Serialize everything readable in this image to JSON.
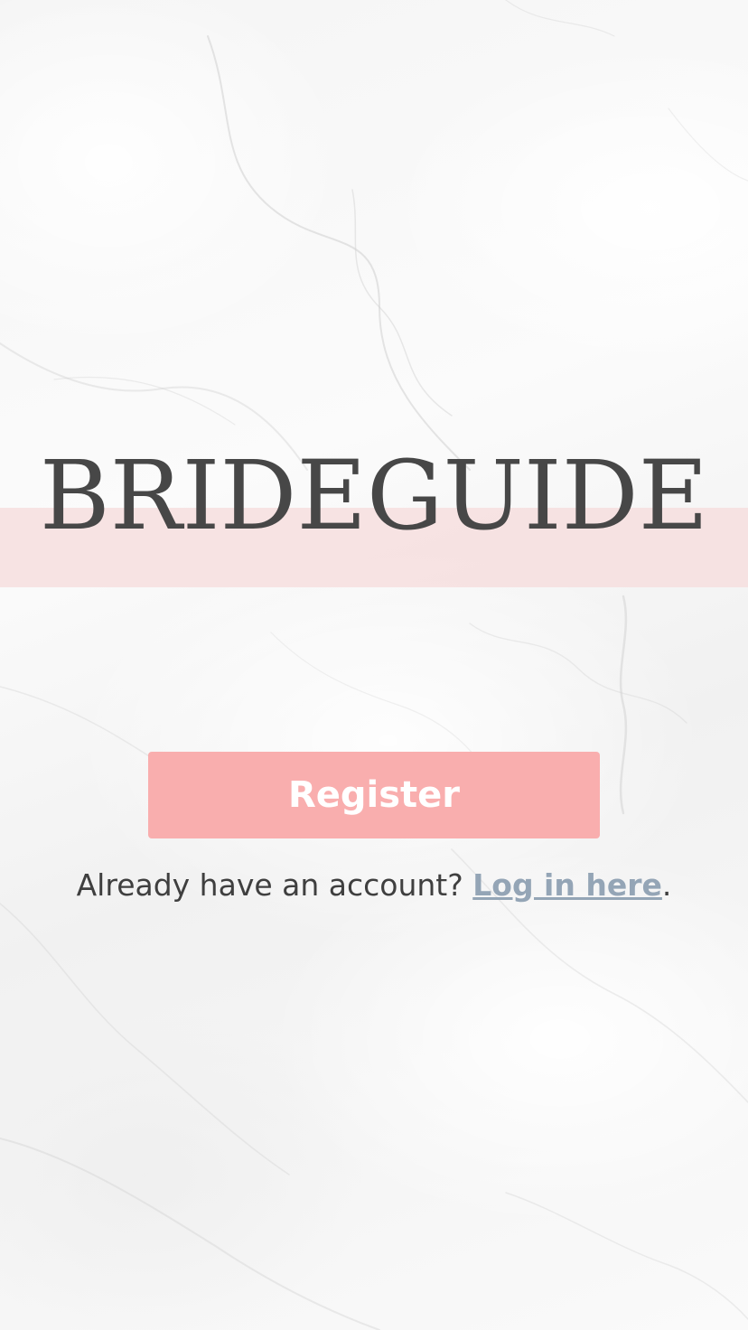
{
  "brand": {
    "title": "BRIDEGUIDE"
  },
  "actions": {
    "register_label": "Register"
  },
  "login": {
    "prompt": "Already have an account? ",
    "link_label": "Log in here",
    "suffix": "."
  },
  "colors": {
    "accent": "#f9aeae",
    "band": "#f6dcdd",
    "link": "#94a5b6",
    "text": "#474747"
  }
}
